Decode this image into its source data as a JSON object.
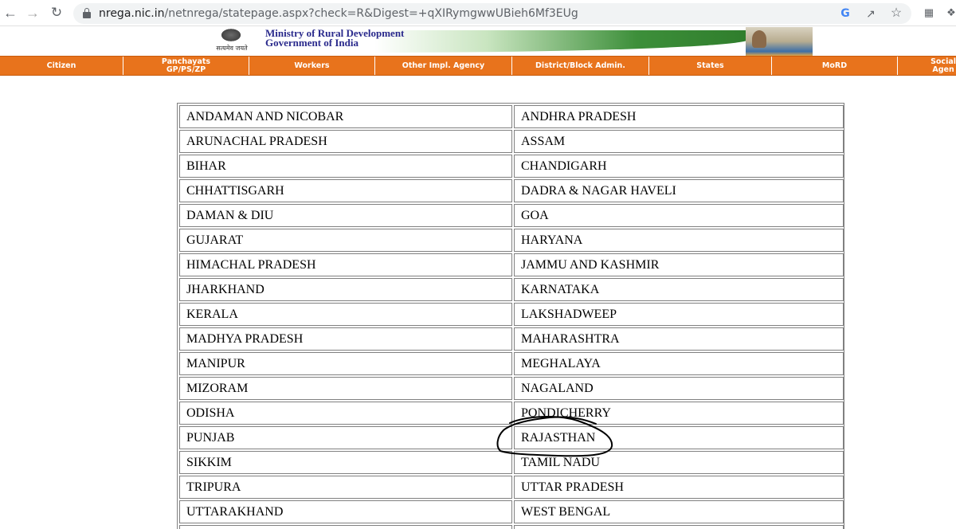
{
  "browser": {
    "url_host": "nrega.nic.in",
    "url_path": "/netnrega/statepage.aspx?check=R&Digest=+qXIRymgwwUBieh6Mf3EUg"
  },
  "header": {
    "emblem_motto": "सत्यमेव जयते",
    "ministry": "Ministry of Rural Development",
    "government": "Government of India"
  },
  "menu": {
    "items": [
      {
        "label": "Citizen"
      },
      {
        "label": "Panchayats\nGP/PS/ZP"
      },
      {
        "label": "Workers"
      },
      {
        "label": "Other Impl. Agency"
      },
      {
        "label": "District/Block Admin."
      },
      {
        "label": "States"
      },
      {
        "label": "MoRD"
      },
      {
        "label": "Social\nAgen"
      }
    ]
  },
  "states": [
    "ANDAMAN AND NICOBAR",
    "ANDHRA PRADESH",
    "ARUNACHAL PRADESH",
    "ASSAM",
    "BIHAR",
    "CHANDIGARH",
    "CHHATTISGARH",
    "DADRA & NAGAR HAVELI",
    "DAMAN & DIU",
    "GOA",
    "GUJARAT",
    "HARYANA",
    "HIMACHAL PRADESH",
    "JAMMU AND KASHMIR",
    "JHARKHAND",
    "KARNATAKA",
    "KERALA",
    "LAKSHADWEEP",
    "MADHYA PRADESH",
    "MAHARASHTRA",
    "MANIPUR",
    "MEGHALAYA",
    "MIZORAM",
    "NAGALAND",
    "ODISHA",
    "PONDICHERRY",
    "PUNJAB",
    "RAJASTHAN",
    "SIKKIM",
    "TAMIL NADU",
    "TRIPURA",
    "UTTAR PRADESH",
    "UTTARAKHAND",
    "WEST BENGAL",
    "",
    ""
  ],
  "annotation": {
    "circled_state": "RAJASTHAN",
    "stroke_color": "#000000"
  },
  "colors": {
    "menu_bg": "#e8731c",
    "menu_text": "#ffffff",
    "ministry_text": "#2a2a8c"
  }
}
